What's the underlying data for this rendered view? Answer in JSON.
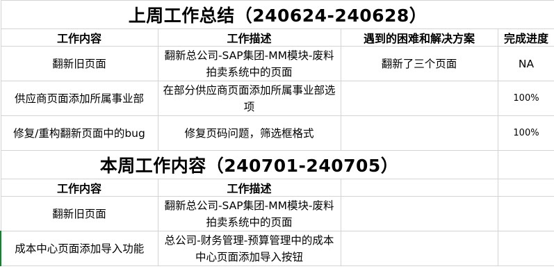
{
  "last_week": {
    "title": "上周工作总结（240624-240628）",
    "headers": [
      "工作内容",
      "工作描述",
      "遇到的困难和解决方案",
      "完成进度"
    ],
    "rows": [
      {
        "content": "翻新旧页面",
        "description": "翻新总公司-SAP集团-MM模块-废料拍卖系统中的页面",
        "issues": "翻新了三个页面",
        "progress": "NA"
      },
      {
        "content": "供应商页面添加所属事业部",
        "description": "在部分供应商页面添加所属事业部选项",
        "issues": "",
        "progress": "100%"
      },
      {
        "content": "修复/重构翻新页面中的bug",
        "description": "修复页码问题，筛选框格式",
        "issues": "",
        "progress": "100%"
      }
    ]
  },
  "this_week": {
    "title": "本周工作内容（240701-240705）",
    "headers": [
      "工作内容",
      "工作描述",
      "",
      ""
    ],
    "rows": [
      {
        "content": "翻新旧页面",
        "description": "翻新总公司-SAP集团-MM模块-废料拍卖系统中的页面",
        "issues": "",
        "progress": ""
      },
      {
        "content": "成本中心页面添加导入功能",
        "description": "总公司-财务管理-预算管理中的成本中心页面添加导入按钮",
        "issues": "",
        "progress": ""
      }
    ]
  }
}
